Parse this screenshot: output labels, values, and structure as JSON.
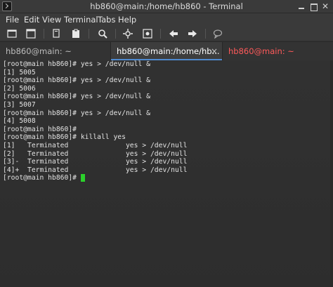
{
  "window": {
    "title": "hb860@main:/home/hb860 - Terminal"
  },
  "menu": {
    "items": [
      "File",
      "Edit",
      "View",
      "Terminal",
      "Tabs",
      "Help"
    ]
  },
  "toolbar": {
    "icons": [
      "new-tab-icon",
      "new-window-icon",
      "copy-icon",
      "paste-icon",
      "find-icon",
      "fullscreen-icon",
      "preferences-icon",
      "previous-tab-icon",
      "next-tab-icon",
      "about-icon"
    ]
  },
  "tabs": [
    {
      "label": "hb860@main: ~",
      "state": "inactive"
    },
    {
      "label": "hb860@main:/home/hb...",
      "state": "active",
      "close": "×"
    },
    {
      "label": "hb860@main: ~",
      "state": "inactive"
    }
  ],
  "colors": {
    "active_tab_accent": "#4f8ad0",
    "third_tab_text": "#ff5a5a",
    "cursor": "#2bd02b",
    "terminal_bg": "#2e2e2e"
  },
  "terminal": {
    "lines": [
      "[root@main hb860]# yes > /dev/null &",
      "[1] 5005",
      "[root@main hb860]# yes > /dev/null &",
      "[2] 5006",
      "[root@main hb860]# yes > /dev/null &",
      "[3] 5007",
      "[root@main hb860]# yes > /dev/null &",
      "[4] 5008",
      "[root@main hb860]#",
      "[root@main hb860]# killall yes",
      "[1]   Terminated              yes > /dev/null",
      "[2]   Terminated              yes > /dev/null",
      "[3]-  Terminated              yes > /dev/null",
      "[4]+  Terminated              yes > /dev/null"
    ],
    "prompt": "[root@main hb860]# "
  }
}
